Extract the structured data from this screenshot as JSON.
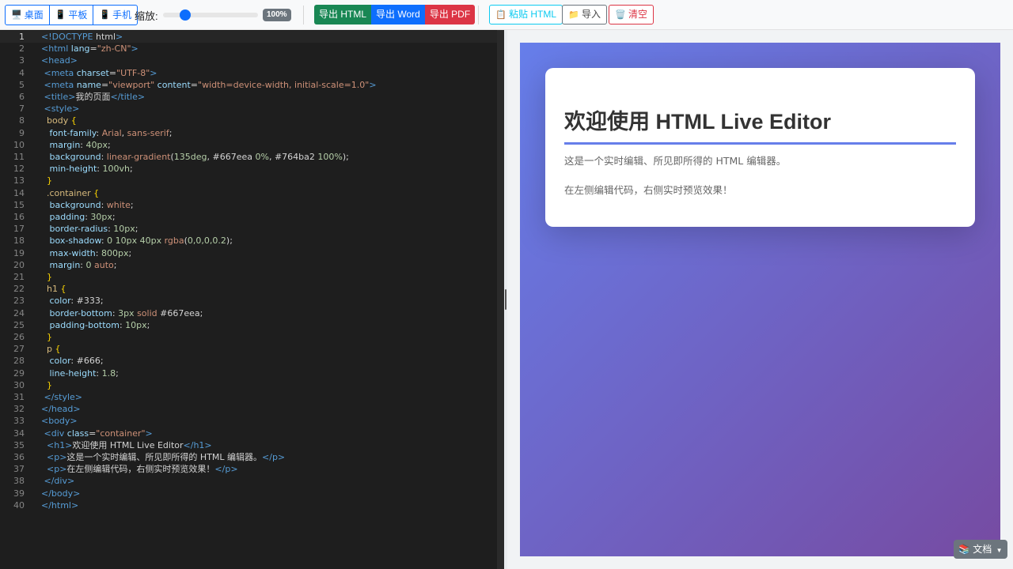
{
  "toolbar": {
    "device_buttons": [
      {
        "icon": "🖥️",
        "label": "桌面"
      },
      {
        "icon": "📱",
        "label": "平板"
      },
      {
        "icon": "📱",
        "label": "手机"
      }
    ],
    "zoom": {
      "label": "缩放:",
      "value": "100%",
      "level": 0.2
    },
    "export": {
      "html": "导出 HTML",
      "word": "导出 Word",
      "pdf": "导出 PDF"
    },
    "paste": {
      "icon": "📋",
      "label": "粘贴 HTML"
    },
    "import": {
      "icon": "📁",
      "label": "导入"
    },
    "clear": {
      "icon": "🗑️",
      "label": "清空"
    }
  },
  "editor": {
    "active_line": 1,
    "lines": [
      [
        [
          "t-tag",
          "<!DOCTYPE "
        ],
        [
          "t-tagname",
          "html"
        ],
        [
          "t-tag",
          ">"
        ]
      ],
      [
        [
          "t-tag",
          "<html "
        ],
        [
          "t-attr",
          "lang"
        ],
        [
          "t-txt",
          "="
        ],
        [
          "t-str",
          "\"zh-CN\""
        ],
        [
          "t-tag",
          ">"
        ]
      ],
      [
        [
          "t-tag",
          "<head>"
        ]
      ],
      [
        [
          "t-txt",
          " "
        ],
        [
          "t-tag",
          "<meta "
        ],
        [
          "t-attr",
          "charset"
        ],
        [
          "t-txt",
          "="
        ],
        [
          "t-str",
          "\"UTF-8\""
        ],
        [
          "t-tag",
          ">"
        ]
      ],
      [
        [
          "t-txt",
          " "
        ],
        [
          "t-tag",
          "<meta "
        ],
        [
          "t-attr",
          "name"
        ],
        [
          "t-txt",
          "="
        ],
        [
          "t-str",
          "\"viewport\""
        ],
        [
          "t-txt",
          " "
        ],
        [
          "t-attr",
          "content"
        ],
        [
          "t-txt",
          "="
        ],
        [
          "t-str",
          "\"width=device-width, initial-scale=1.0\""
        ],
        [
          "t-tag",
          ">"
        ]
      ],
      [
        [
          "t-txt",
          " "
        ],
        [
          "t-tag",
          "<title>"
        ],
        [
          "t-txt",
          "我的页面"
        ],
        [
          "t-tag",
          "</title>"
        ]
      ],
      [
        [
          "t-txt",
          " "
        ],
        [
          "t-tag",
          "<style>"
        ]
      ],
      [
        [
          "t-txt",
          "  "
        ],
        [
          "t-sel",
          "body "
        ],
        [
          "t-brace",
          "{"
        ]
      ],
      [
        [
          "t-txt",
          "   "
        ],
        [
          "t-prop",
          "font-family"
        ],
        [
          "t-txt",
          ": "
        ],
        [
          "t-kw",
          "Arial"
        ],
        [
          "t-txt",
          ", "
        ],
        [
          "t-kw",
          "sans-serif"
        ],
        [
          "t-txt",
          ";"
        ]
      ],
      [
        [
          "t-txt",
          "   "
        ],
        [
          "t-prop",
          "margin"
        ],
        [
          "t-txt",
          ": "
        ],
        [
          "t-num",
          "40px"
        ],
        [
          "t-txt",
          ";"
        ]
      ],
      [
        [
          "t-txt",
          "   "
        ],
        [
          "t-prop",
          "background"
        ],
        [
          "t-txt",
          ": "
        ],
        [
          "t-kw",
          "linear-gradient"
        ],
        [
          "t-txt",
          "("
        ],
        [
          "t-num",
          "135deg"
        ],
        [
          "t-txt",
          ", #667eea "
        ],
        [
          "t-num",
          "0%"
        ],
        [
          "t-txt",
          ", #764ba2 "
        ],
        [
          "t-num",
          "100%"
        ],
        [
          "t-txt",
          ");"
        ]
      ],
      [
        [
          "t-txt",
          "   "
        ],
        [
          "t-prop",
          "min-height"
        ],
        [
          "t-txt",
          ": "
        ],
        [
          "t-num",
          "100vh"
        ],
        [
          "t-txt",
          ";"
        ]
      ],
      [
        [
          "t-txt",
          "  "
        ],
        [
          "t-brace",
          "}"
        ]
      ],
      [
        [
          "t-txt",
          "  "
        ],
        [
          "t-sel",
          ".container "
        ],
        [
          "t-brace",
          "{"
        ]
      ],
      [
        [
          "t-txt",
          "   "
        ],
        [
          "t-prop",
          "background"
        ],
        [
          "t-txt",
          ": "
        ],
        [
          "t-kw",
          "white"
        ],
        [
          "t-txt",
          ";"
        ]
      ],
      [
        [
          "t-txt",
          "   "
        ],
        [
          "t-prop",
          "padding"
        ],
        [
          "t-txt",
          ": "
        ],
        [
          "t-num",
          "30px"
        ],
        [
          "t-txt",
          ";"
        ]
      ],
      [
        [
          "t-txt",
          "   "
        ],
        [
          "t-prop",
          "border-radius"
        ],
        [
          "t-txt",
          ": "
        ],
        [
          "t-num",
          "10px"
        ],
        [
          "t-txt",
          ";"
        ]
      ],
      [
        [
          "t-txt",
          "   "
        ],
        [
          "t-prop",
          "box-shadow"
        ],
        [
          "t-txt",
          ": "
        ],
        [
          "t-num",
          "0 10px 40px "
        ],
        [
          "t-kw",
          "rgba"
        ],
        [
          "t-txt",
          "("
        ],
        [
          "t-num",
          "0,0,0,0.2"
        ],
        [
          "t-txt",
          ");"
        ]
      ],
      [
        [
          "t-txt",
          "   "
        ],
        [
          "t-prop",
          "max-width"
        ],
        [
          "t-txt",
          ": "
        ],
        [
          "t-num",
          "800px"
        ],
        [
          "t-txt",
          ";"
        ]
      ],
      [
        [
          "t-txt",
          "   "
        ],
        [
          "t-prop",
          "margin"
        ],
        [
          "t-txt",
          ": "
        ],
        [
          "t-num",
          "0 "
        ],
        [
          "t-kw",
          "auto"
        ],
        [
          "t-txt",
          ";"
        ]
      ],
      [
        [
          "t-txt",
          "  "
        ],
        [
          "t-brace",
          "}"
        ]
      ],
      [
        [
          "t-txt",
          "  "
        ],
        [
          "t-sel",
          "h1 "
        ],
        [
          "t-brace",
          "{"
        ]
      ],
      [
        [
          "t-txt",
          "   "
        ],
        [
          "t-prop",
          "color"
        ],
        [
          "t-txt",
          ": #333;"
        ]
      ],
      [
        [
          "t-txt",
          "   "
        ],
        [
          "t-prop",
          "border-bottom"
        ],
        [
          "t-txt",
          ": "
        ],
        [
          "t-num",
          "3px "
        ],
        [
          "t-kw",
          "solid"
        ],
        [
          "t-txt",
          " #667eea;"
        ]
      ],
      [
        [
          "t-txt",
          "   "
        ],
        [
          "t-prop",
          "padding-bottom"
        ],
        [
          "t-txt",
          ": "
        ],
        [
          "t-num",
          "10px"
        ],
        [
          "t-txt",
          ";"
        ]
      ],
      [
        [
          "t-txt",
          "  "
        ],
        [
          "t-brace",
          "}"
        ]
      ],
      [
        [
          "t-txt",
          "  "
        ],
        [
          "t-sel",
          "p "
        ],
        [
          "t-brace",
          "{"
        ]
      ],
      [
        [
          "t-txt",
          "   "
        ],
        [
          "t-prop",
          "color"
        ],
        [
          "t-txt",
          ": #666;"
        ]
      ],
      [
        [
          "t-txt",
          "   "
        ],
        [
          "t-prop",
          "line-height"
        ],
        [
          "t-txt",
          ": "
        ],
        [
          "t-num",
          "1.8"
        ],
        [
          "t-txt",
          ";"
        ]
      ],
      [
        [
          "t-txt",
          "  "
        ],
        [
          "t-brace",
          "}"
        ]
      ],
      [
        [
          "t-txt",
          " "
        ],
        [
          "t-tag",
          "</style>"
        ]
      ],
      [
        [
          "t-tag",
          "</head>"
        ]
      ],
      [
        [
          "t-tag",
          "<body>"
        ]
      ],
      [
        [
          "t-txt",
          " "
        ],
        [
          "t-tag",
          "<div "
        ],
        [
          "t-attr",
          "class"
        ],
        [
          "t-txt",
          "="
        ],
        [
          "t-str",
          "\"container\""
        ],
        [
          "t-tag",
          ">"
        ]
      ],
      [
        [
          "t-txt",
          "  "
        ],
        [
          "t-tag",
          "<h1>"
        ],
        [
          "t-txt",
          "欢迎使用 HTML Live Editor"
        ],
        [
          "t-tag",
          "</h1>"
        ]
      ],
      [
        [
          "t-txt",
          "  "
        ],
        [
          "t-tag",
          "<p>"
        ],
        [
          "t-txt",
          "这是一个实时编辑、所见即所得的 HTML 编辑器。"
        ],
        [
          "t-tag",
          "</p>"
        ]
      ],
      [
        [
          "t-txt",
          "  "
        ],
        [
          "t-tag",
          "<p>"
        ],
        [
          "t-txt",
          "在左侧编辑代码，右侧实时预览效果！"
        ],
        [
          "t-tag",
          "</p>"
        ]
      ],
      [
        [
          "t-txt",
          " "
        ],
        [
          "t-tag",
          "</div>"
        ]
      ],
      [
        [
          "t-tag",
          "</body>"
        ]
      ],
      [
        [
          "t-tag",
          "</html>"
        ]
      ]
    ]
  },
  "preview": {
    "heading": "欢迎使用 HTML Live Editor",
    "paragraphs": [
      "这是一个实时编辑、所见即所得的 HTML 编辑器。",
      "在左侧编辑代码，右侧实时预览效果！"
    ]
  },
  "docs_button": {
    "icon": "📚",
    "label": "文档"
  }
}
